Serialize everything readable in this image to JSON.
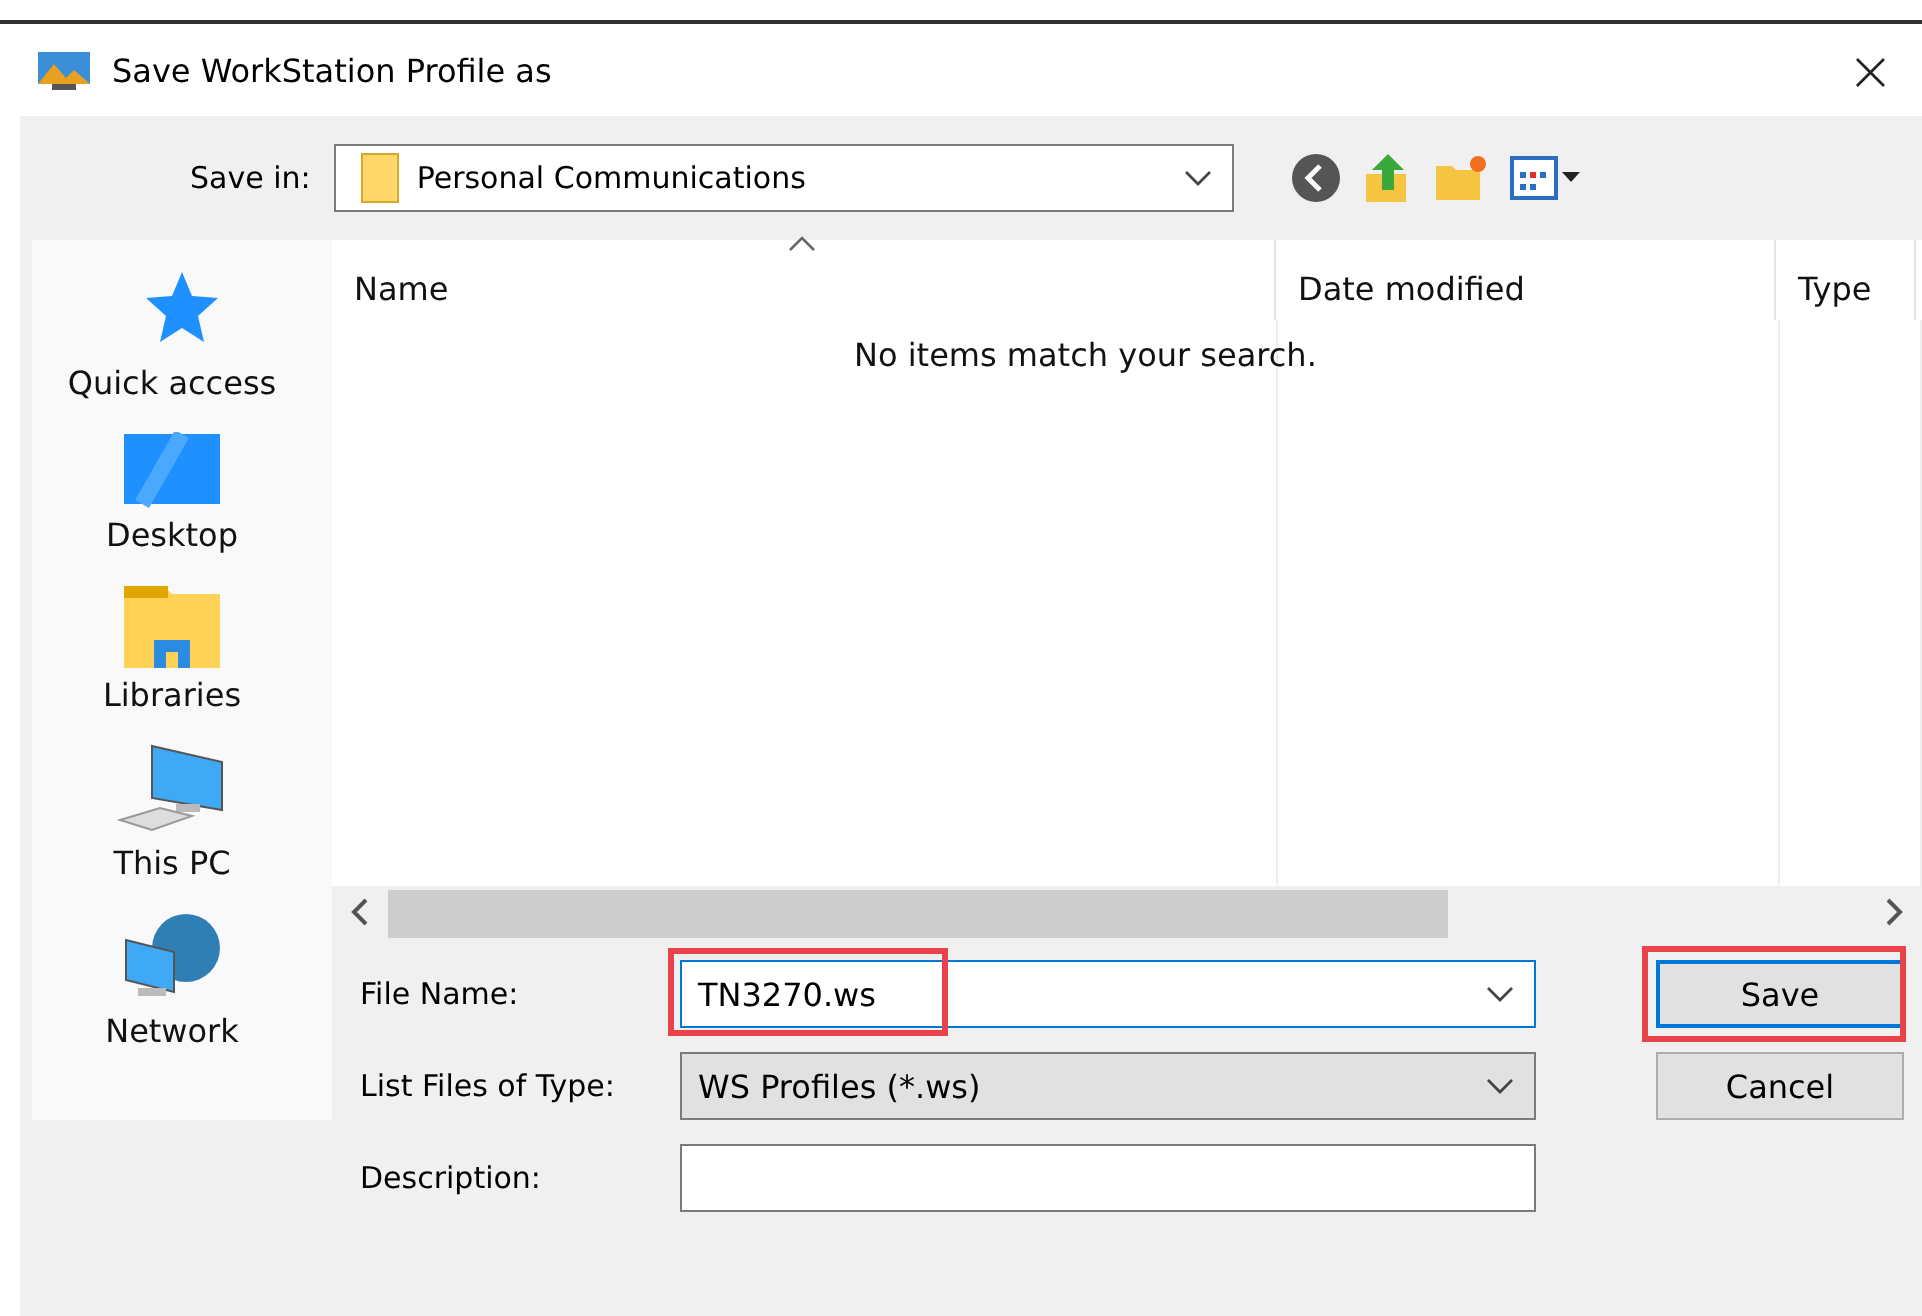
{
  "window": {
    "title": "Save WorkStation Profile as",
    "close": "×"
  },
  "save_in": {
    "label": "Save in:",
    "value": "Personal Communications"
  },
  "sidebar": {
    "items": [
      {
        "label": "Quick access",
        "kind": "star"
      },
      {
        "label": "Desktop",
        "kind": "desktop"
      },
      {
        "label": "Libraries",
        "kind": "libraries"
      },
      {
        "label": "This PC",
        "kind": "pc"
      },
      {
        "label": "Network",
        "kind": "network"
      }
    ]
  },
  "file_list": {
    "columns": [
      {
        "label": "Name",
        "sorted": true
      },
      {
        "label": "Date modified"
      },
      {
        "label": "Type"
      }
    ],
    "empty_message": "No items match your search."
  },
  "form": {
    "fields": [
      {
        "label": "File Name:",
        "kind": "combo",
        "value": "TN3270.ws",
        "highlighted": true,
        "focused": true
      },
      {
        "label": "List Files of Type:",
        "kind": "select",
        "value": "WS Profiles (*.ws)",
        "focused": false
      },
      {
        "label": "Description:",
        "kind": "text",
        "focused": false
      }
    ]
  },
  "buttons": [
    {
      "label": "Save",
      "default": true,
      "highlighted": true
    },
    {
      "label": "Cancel",
      "default": false
    }
  ]
}
